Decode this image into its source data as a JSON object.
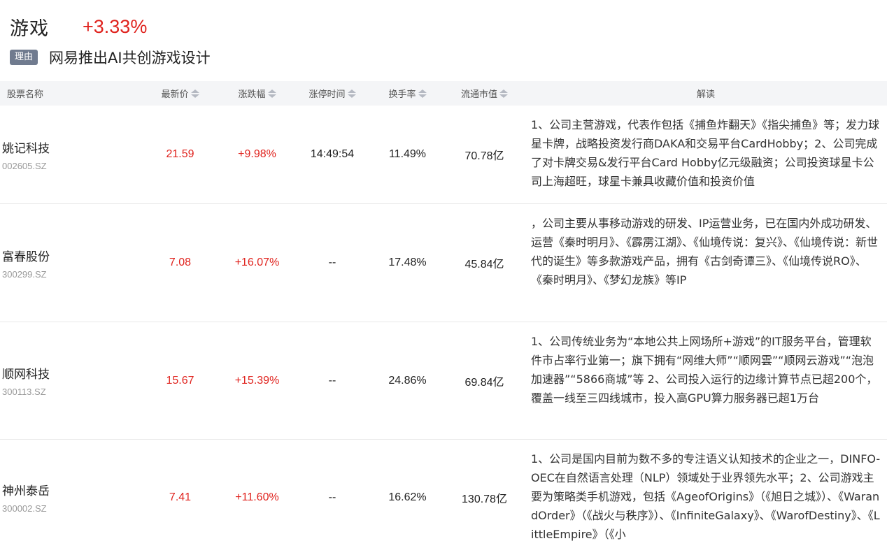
{
  "sector": {
    "name": "游戏",
    "change": "+3.33%"
  },
  "reason": {
    "badge": "理由",
    "text": "网易推出AI共创游戏设计"
  },
  "table": {
    "headers": {
      "name": "股票名称",
      "price": "最新价",
      "change": "涨跌幅",
      "limit_time": "涨停时间",
      "turnover": "换手率",
      "market_cap": "流通市值",
      "desc": "解读"
    },
    "rows": [
      {
        "name": "姚记科技",
        "code": "002605.SZ",
        "price": "21.59",
        "change": "+9.98%",
        "limit_time": "14:49:54",
        "turnover": "11.49%",
        "market_cap": "70.78亿",
        "desc": "1、公司主营游戏，代表作包括《捕鱼炸翻天》《指尖捕鱼》等；发力球星卡牌，战略投资发行商DAKA和交易平台CardHobby；2、公司完成了对卡牌交易&发行平台Card Hobby亿元级融资；公司投资球星卡公司上海超旺，球星卡兼具收藏价值和投资价值"
      },
      {
        "name": "富春股份",
        "code": "300299.SZ",
        "price": "7.08",
        "change": "+16.07%",
        "limit_time": "--",
        "turnover": "17.48%",
        "market_cap": "45.84亿",
        "desc": "，公司主要从事移动游戏的研发、IP运营业务，已在国内外成功研发、运营《秦时明月》、《霹雳江湖》、《仙境传说：复兴》、《仙境传说：新世代的诞生》等多款游戏产品，拥有《古剑奇谭三》、《仙境传说RO》、《秦时明月》、《梦幻龙族》等IP"
      },
      {
        "name": "顺网科技",
        "code": "300113.SZ",
        "price": "15.67",
        "change": "+15.39%",
        "limit_time": "--",
        "turnover": "24.86%",
        "market_cap": "69.84亿",
        "desc": "1、公司传统业务为“本地公共上网场所+游戏”的IT服务平台，管理软件市占率行业第一；旗下拥有“网维大师”“顺网雲”“顺网云游戏”“泡泡加速器”“5866商城”等 2、公司投入运行的边缘计算节点已超200个，覆盖一线至三四线城市，投入高GPU算力服务器已超1万台"
      },
      {
        "name": "神州泰岳",
        "code": "300002.SZ",
        "price": "7.41",
        "change": "+11.60%",
        "limit_time": "--",
        "turnover": "16.62%",
        "market_cap": "130.78亿",
        "desc": "1、公司是国内目前为数不多的专注语义认知技术的企业之一，DINFO-OEC在自然语言处理（NLP）领域处于业界领先水平；2、公司游戏主要为策略类手机游戏，包括《AgeofOrigins》（《旭日之城》）、《WarandOrder》（《战火与秩序》）、《InfiniteGalaxy》、《WarofDestiny》、《LittleEmpire》（《小"
      }
    ]
  },
  "colors": {
    "up": "#e0231e",
    "badge_bg": "#707b8f",
    "header_bg": "#f4f5f7"
  }
}
